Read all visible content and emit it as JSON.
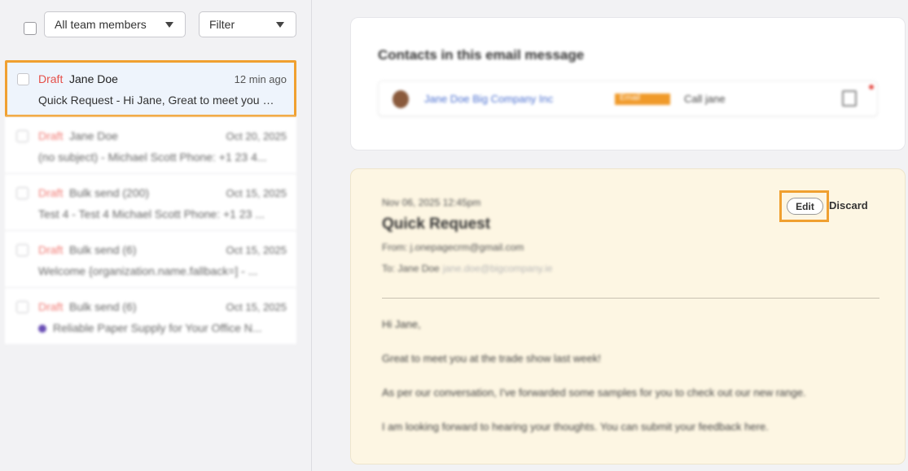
{
  "toolbar": {
    "team_filter": "All team members",
    "filter": "Filter"
  },
  "emails": [
    {
      "status": "Draft",
      "name": "Jane Doe",
      "time": "12 min ago",
      "preview": "Quick Request - Hi Jane, Great to meet you at the trade show last week!"
    },
    {
      "status": "Draft",
      "name": "Jane Doe",
      "time": "Oct 20, 2025",
      "preview": "(no subject) - Michael Scott Phone: +1 23 4..."
    },
    {
      "status": "Draft",
      "name": "Bulk send (200)",
      "time": "Oct 15, 2025",
      "preview": "Test 4 - Test 4 Michael Scott Phone: +1 23 ..."
    },
    {
      "status": "Draft",
      "name": "Bulk send (6)",
      "time": "Oct 15, 2025",
      "preview": "Welcome {organization.name.fallback=] - ..."
    },
    {
      "status": "Draft",
      "name": "Bulk send (6)",
      "time": "Oct 15, 2025",
      "preview": "Reliable Paper Supply for Your Office N..."
    }
  ],
  "contacts": {
    "heading": "Contacts in this email message",
    "contact_name": "Jane Doe Big Company Inc",
    "tag": "Email",
    "task": "Call jane"
  },
  "message": {
    "date": "Nov 06, 2025 12:45pm",
    "subject": "Quick Request",
    "from": "From: j.onepagecrm@gmail.com",
    "to": "To: Jane Doe",
    "to_email": "jane.doe@bigcompany.ie",
    "edit_label": "Edit",
    "discard_label": "Discard",
    "body": [
      "Hi Jane,",
      "Great to meet you at the trade show last week!",
      "As per our conversation, I've forwarded some samples for you to check out our new range.",
      "I am looking forward to hearing your thoughts. You can submit your feedback here."
    ]
  }
}
